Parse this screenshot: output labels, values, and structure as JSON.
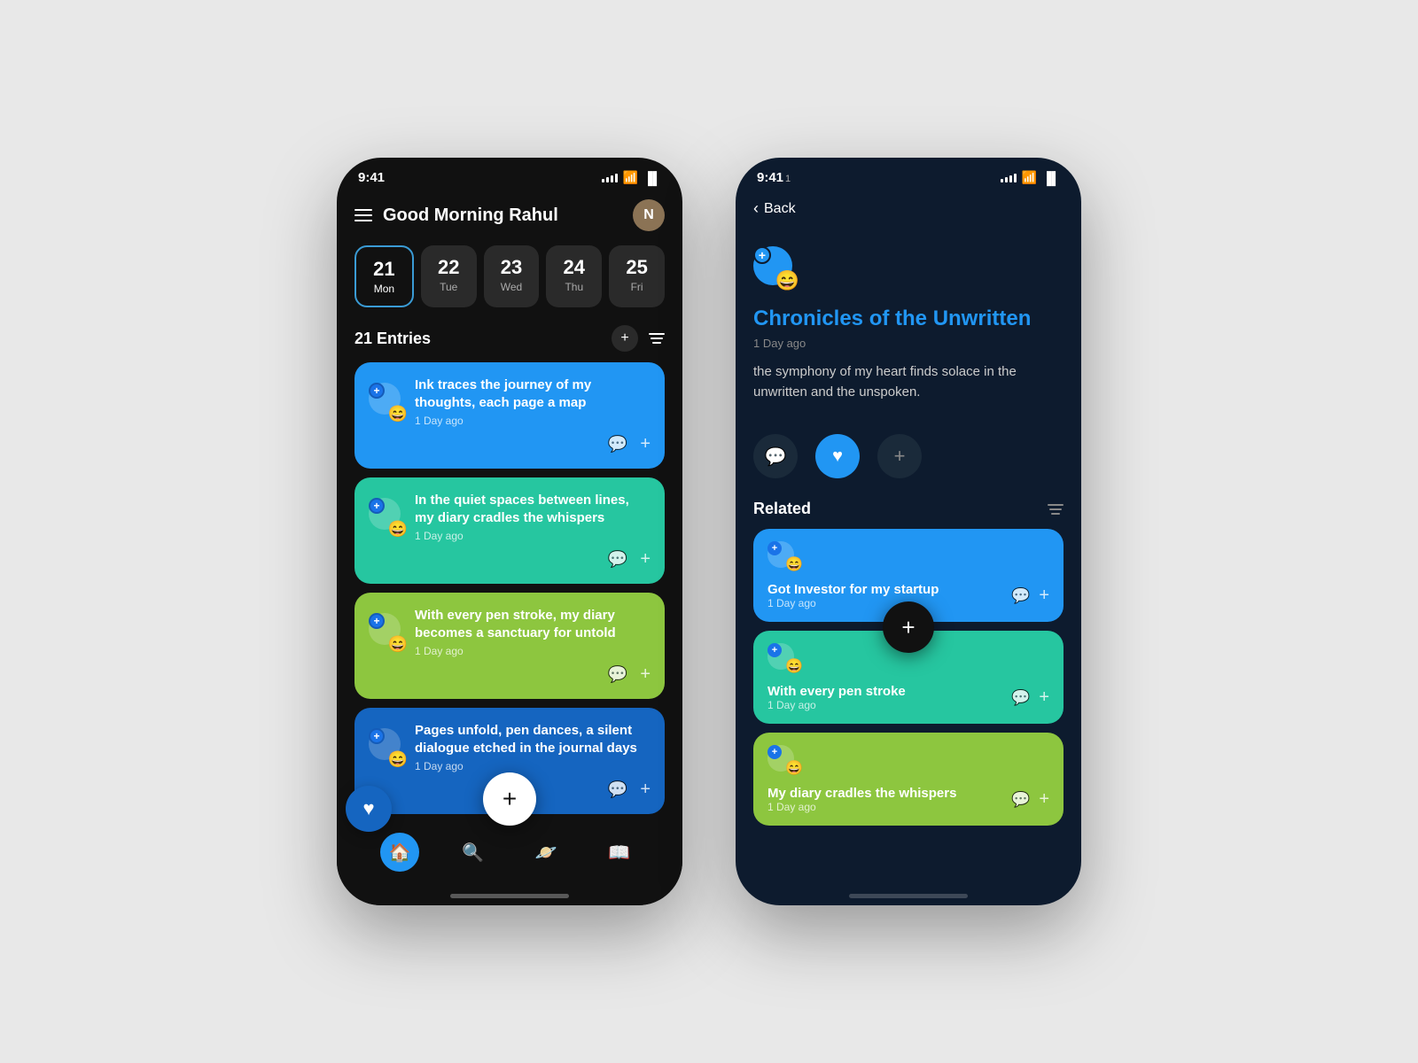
{
  "phone1": {
    "statusBar": {
      "time": "9:41",
      "signalBars": [
        3,
        5,
        7,
        9,
        11
      ],
      "wifiIcon": "📶",
      "batteryIcon": "🔋"
    },
    "header": {
      "menuLabel": "menu",
      "title": "Good Morning Rahul",
      "avatarInitial": "N"
    },
    "dates": [
      {
        "num": "21",
        "day": "Mon",
        "active": true
      },
      {
        "num": "22",
        "day": "Tue",
        "active": false
      },
      {
        "num": "23",
        "day": "Wed",
        "active": false
      },
      {
        "num": "24",
        "day": "Thu",
        "active": false
      },
      {
        "num": "25",
        "day": "Fri",
        "active": false
      }
    ],
    "entriesHeader": {
      "title": "21 Entries",
      "addLabel": "+",
      "filterLabel": "filter"
    },
    "cards": [
      {
        "emoji": "😄",
        "title": "Ink traces the journey of my thoughts, each page a map",
        "time": "1 Day ago",
        "color": "blue"
      },
      {
        "emoji": "😄",
        "title": "In the quiet spaces between lines, my diary cradles the whispers",
        "time": "1 Day ago",
        "color": "teal"
      },
      {
        "emoji": "😄",
        "title": "With every pen stroke, my diary becomes a sanctuary for untold",
        "time": "1 Day ago",
        "color": "green"
      },
      {
        "emoji": "😄",
        "title": "Pages unfold, pen dances, a silent dialogue etched in the journal days",
        "time": "1 Day ago",
        "color": "blue-dark"
      }
    ],
    "nav": [
      {
        "icon": "🏠",
        "label": "home",
        "active": true
      },
      {
        "icon": "🔍",
        "label": "search",
        "active": false
      },
      {
        "icon": "🪐",
        "label": "explore",
        "active": false
      },
      {
        "icon": "📖",
        "label": "library",
        "active": false
      }
    ]
  },
  "phone2": {
    "statusBar": {
      "time": "9:41",
      "extra": "1"
    },
    "backLabel": "Back",
    "entry": {
      "emoji": "😄",
      "title": "Chronicles of the Unwritten",
      "time": "1 Day ago",
      "content": "the symphony of my heart finds solace in the unwritten and the unspoken."
    },
    "actions": {
      "commentLabel": "comment",
      "likeLabel": "like",
      "addLabel": "add"
    },
    "related": {
      "headerLabel": "Related",
      "cards": [
        {
          "emoji": "😄",
          "title": "Got Investor for my startup",
          "time": "1 Day ago",
          "color": "blue"
        },
        {
          "emoji": "😄",
          "title": "With every pen stroke",
          "time": "1 Day ago",
          "color": "teal"
        },
        {
          "emoji": "😄",
          "title": "My diary cradles the whispers",
          "time": "1 Day ago",
          "color": "green"
        }
      ]
    }
  }
}
